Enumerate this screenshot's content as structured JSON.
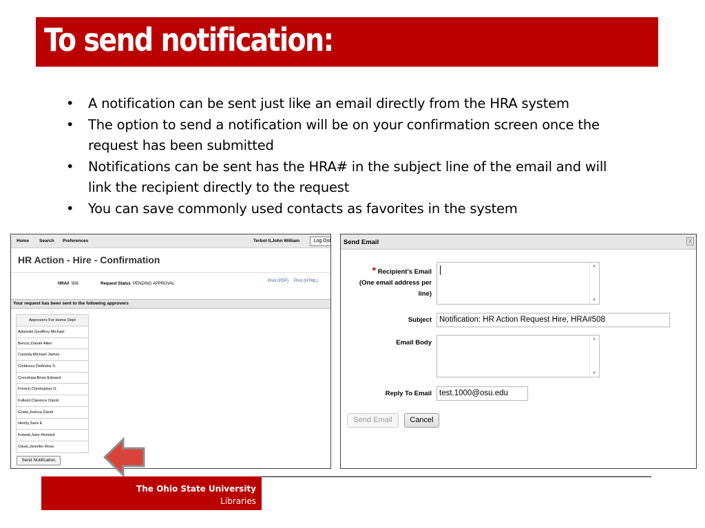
{
  "slide": {
    "title": "To send notification:",
    "bullets": [
      "A notification can be sent just like an email directly from the HRA system",
      "The option to send a notification will be on your confirmation screen once the request has been submitted",
      "Notifications can be sent has the HRA# in the subject line of the email and will link the recipient directly to the request",
      "You can save commonly used contacts as favorites in the system"
    ],
    "bullet_symbol": "•"
  },
  "confirmation_screen": {
    "nav": {
      "home": "Home",
      "search": "Search",
      "preferences": "Preferences",
      "user": "Terbot II,John William",
      "logout": "Log Out"
    },
    "heading": "HR Action - Hire - Confirmation",
    "hra_label": "HRA#",
    "hra_value": "508",
    "status_label": "Request Status",
    "status_value": "PENDING APPROVAL",
    "print_pdf": "Print (PDF)",
    "print_html": "Print (HTML)",
    "sent_message": "Your request has been sent to the following approvers",
    "approvers_header": "Approvers For Home Dept",
    "approvers": [
      "Adamski,Geoffrey Michael",
      "Bencic,Daniel Allen",
      "Cassidy,Michael James",
      "Childress,DeAndra S",
      "Crenshaw,Brian Edward",
      "French,Christopher G",
      "Fullard,Clarence David",
      "Grant,Joshua David",
      "Hemly,Sara E",
      "Kotwal,Juee Hemant",
      "Olson,Jennifer Rose"
    ],
    "send_button": "Send Notification"
  },
  "send_email_dialog": {
    "title": "Send Email",
    "close": "X",
    "required_star": "*",
    "recipient_label": "Recipient's Email",
    "recipient_hint_1": "(One email address per",
    "recipient_hint_2": "line)",
    "recipient_value": "",
    "subject_label": "Subject",
    "subject_value": "Notification: HR Action Request Hire, HRA#508",
    "body_label": "Email Body",
    "body_value": "",
    "reply_label": "Reply To Email",
    "reply_value": "test.1000@osu.edu",
    "send_button": "Send Email",
    "cancel_button": "Cancel"
  },
  "footer": {
    "university": "The Ohio State University",
    "unit": "Libraries"
  },
  "colors": {
    "brand_red": "#bb0000",
    "arrow_red": "#d9443a",
    "arrow_border": "#999999"
  }
}
